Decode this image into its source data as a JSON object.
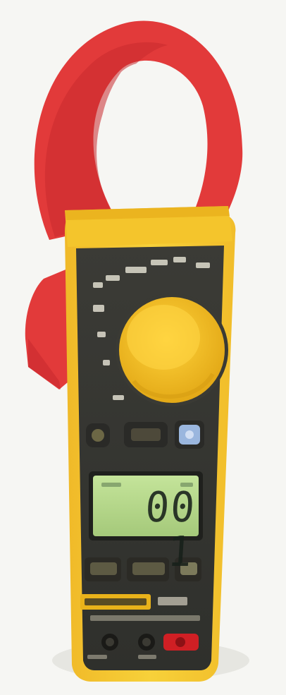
{
  "photo": {
    "subject": "clamp-meter",
    "lcd_reading": "00 1",
    "colors": {
      "jaw": "#e23a3a",
      "jaw_shadow": "#c92a2e",
      "body": "#f2c72b",
      "body_edge": "#e3a917",
      "panel": "#3c3d37",
      "lcd": "#b7d78a",
      "button_blue": "#9ab6de",
      "button_dark": "#55513c",
      "brand_badge": "#e9b21a",
      "background": "#f6f6f3"
    },
    "icons": {
      "jaw": "clamp-jaw-icon",
      "dial": "rotary-dial-icon",
      "backlight": "backlight-button-icon"
    }
  }
}
